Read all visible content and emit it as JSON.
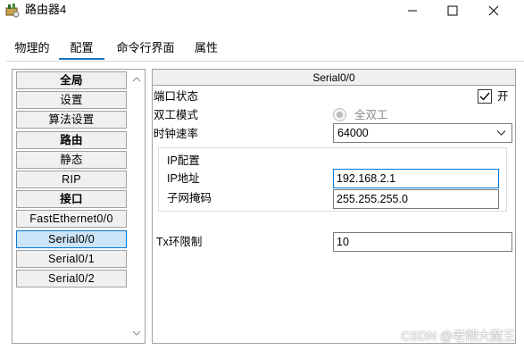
{
  "window": {
    "title": "路由器4",
    "icon": "router-icon"
  },
  "tabs": [
    {
      "label": "物理的"
    },
    {
      "label": "配置",
      "active": true
    },
    {
      "label": "命令行界面"
    },
    {
      "label": "属性"
    }
  ],
  "sidebar": {
    "items": [
      {
        "label": "全局",
        "header": true
      },
      {
        "label": "设置"
      },
      {
        "label": "算法设置"
      },
      {
        "label": "路由",
        "header": true
      },
      {
        "label": "静态"
      },
      {
        "label": "RIP"
      },
      {
        "label": "接口",
        "header": true
      },
      {
        "label": "FastEthernet0/0"
      },
      {
        "label": "Serial0/0",
        "selected": true
      },
      {
        "label": "Serial0/1"
      },
      {
        "label": "Serial0/2"
      }
    ]
  },
  "panel": {
    "title": "Serial0/0",
    "port_status": {
      "label": "端口状态",
      "checkbox_label": "开",
      "checked": true
    },
    "duplex": {
      "label": "双工模式",
      "option_label": "全双工"
    },
    "clock_rate": {
      "label": "时钟速率",
      "value": "64000"
    },
    "ip_config": {
      "group_label": "IP配置",
      "ip_label": "IP地址",
      "ip_value": "192.168.2.1",
      "mask_label": "子网掩码",
      "mask_value": "255.255.255.0"
    },
    "tx_limit": {
      "label": "Tx环限制",
      "value": "10"
    }
  },
  "watermark": "CSDN @老彻大魔王",
  "colors": {
    "accent": "#1a73c8",
    "selected_bg": "#cce4f7"
  }
}
